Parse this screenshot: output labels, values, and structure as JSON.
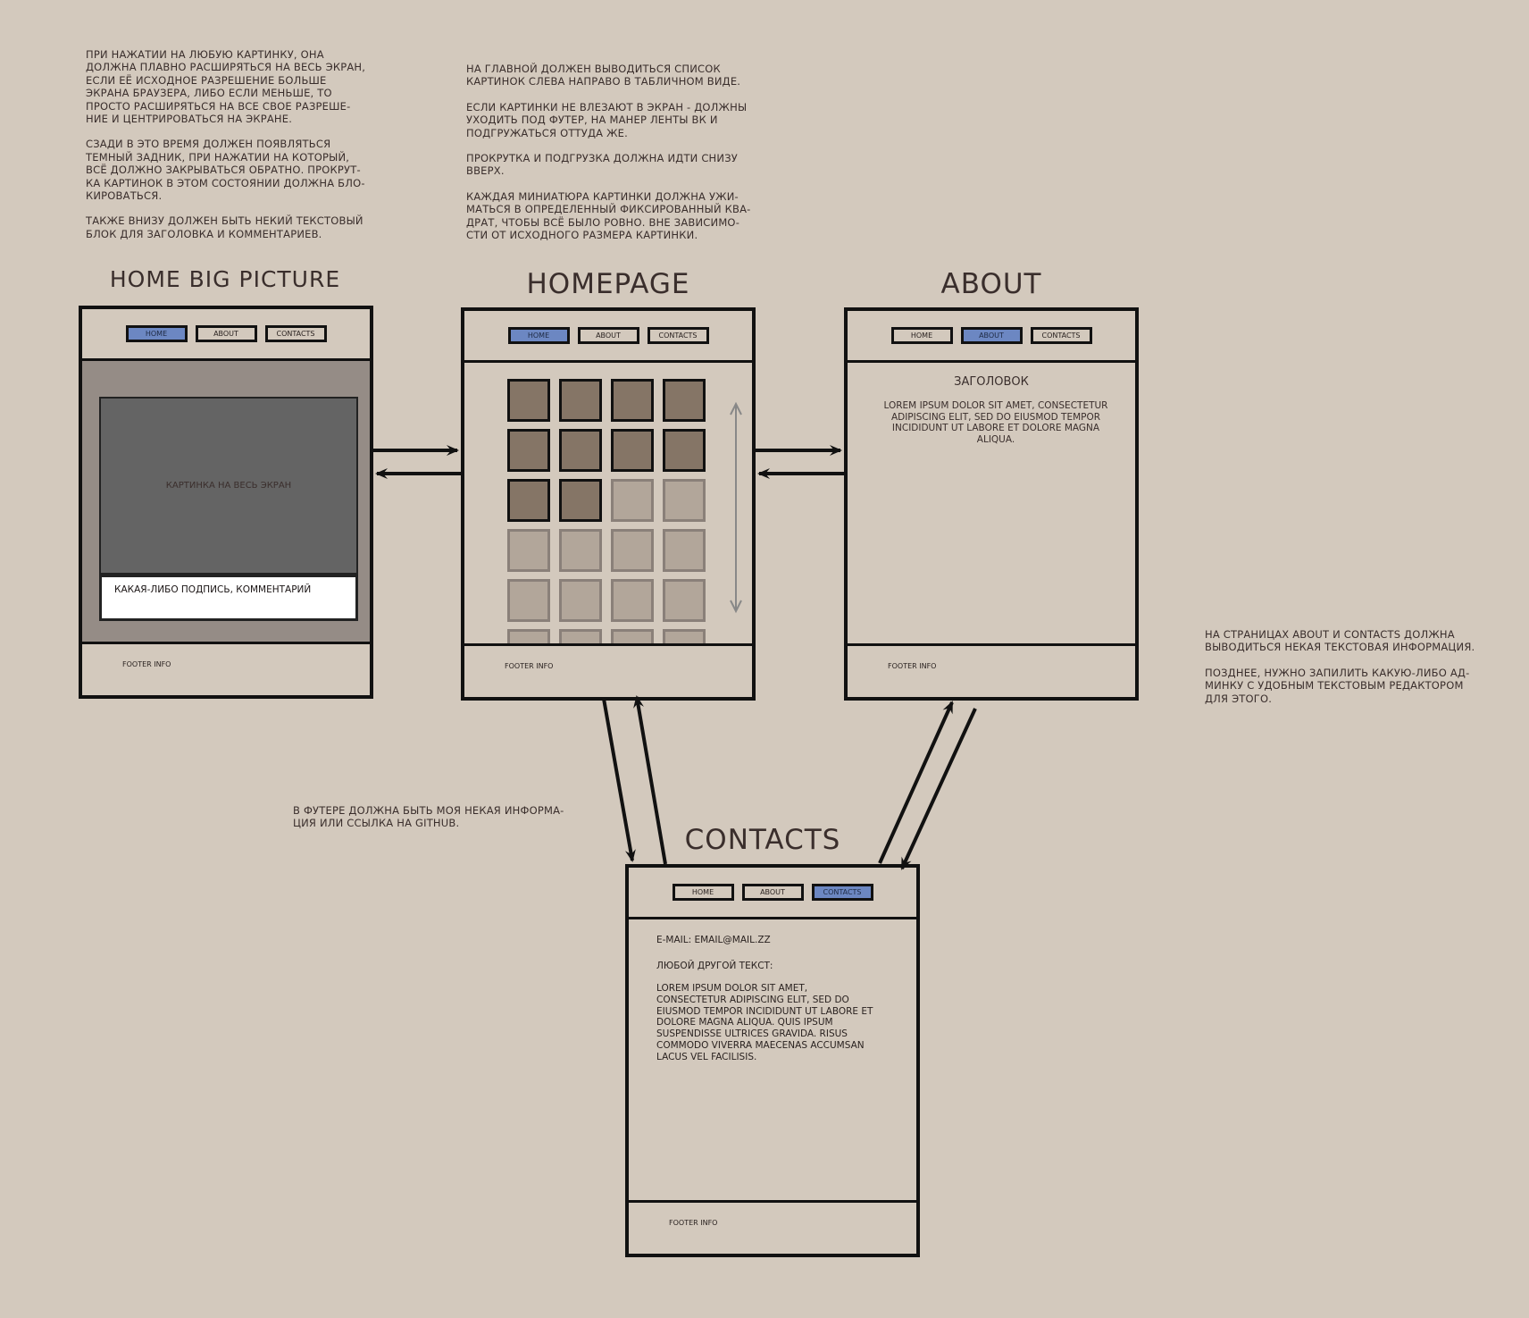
{
  "notes": {
    "top_left": [
      "При нажатии на любую картинку, она\nдолжна плавно расширяться на весь экран,\nесли её исходное разрешение больше\nэкрана браузера, либо если меньше, то\nпросто расширяться на все свое разреше-\nние и центрироваться на экране.",
      "Сзади в это время должен появляться\nтемный задник, при нажатии на который,\nвсё должно закрываться обратно. Прокрут-\nка картинок в этом состоянии должна бло-\nкироваться.",
      "Также внизу должен быть некий текстовый\nблок для заголовка и комментариев."
    ],
    "top_middle": [
      "На главной должен выводиться список\nкартинок слева направо в табличном виде.",
      "Если картинки не влезают в экран - должны\nуходить под футер, на манер ленты ВК и\nподгружаться оттуда же.",
      "Прокрутка и подгрузка должна идти снизу\nвверх.",
      "Каждая миниатюра картинки должна ужи-\nматься в определенный фиксированный ква-\nдрат, чтобы всё было ровно. Вне зависимо-\nсти от исходного размера картинки."
    ],
    "footer_note": "В футере должна быть моя некая информа-\nция или ссылка на github.",
    "right_note": [
      "На страницах About и Contacts должна\nвыводиться некая текстовая информация.",
      "Позднее, нужно запилить какую-либо ад-\nминку с удобным текстовым редактором\nдля этого."
    ]
  },
  "titles": {
    "big_picture": "HOME BIG PICTURE",
    "homepage": "HOMEPAGE",
    "about": "ABOUT",
    "contacts": "CONTACTS"
  },
  "nav": {
    "home": "Home",
    "about": "About",
    "contacts": "Contacts"
  },
  "footer_info": "Footer info",
  "big_picture": {
    "image_label": "Картинка на весь экран",
    "caption": "Какая-либо подпись, комментарий"
  },
  "homepage": {
    "grid_columns": 4,
    "loaded_thumbnails": 10,
    "pending_thumbnails": 10
  },
  "about": {
    "heading": "Заголовок",
    "body": "Lorem ipsum dolor sit amet, consectetur adipiscing elit, sed do eiusmod tempor incididunt ut labore et dolore magna aliqua."
  },
  "contacts": {
    "email": "E-mail: email@mail.zz",
    "other_label": "Любой другой текст:",
    "body": "Lorem ipsum dolor sit amet,\nconsectetur adipiscing elit, sed do\neiusmod tempor incididunt ut labore et\ndolore magna aliqua. Quis ipsum\nsuspendisse ultrices gravida. Risus\ncommodo viverra maecenas accumsan\nlacus vel facilisis."
  },
  "colors": {
    "background": "#d3c9bd",
    "active_nav": "#6c87c2",
    "thumb_loaded": "#857566",
    "thumb_pending": "#b2a69a",
    "overlay": "#958c86",
    "image_placeholder": "#646464"
  }
}
